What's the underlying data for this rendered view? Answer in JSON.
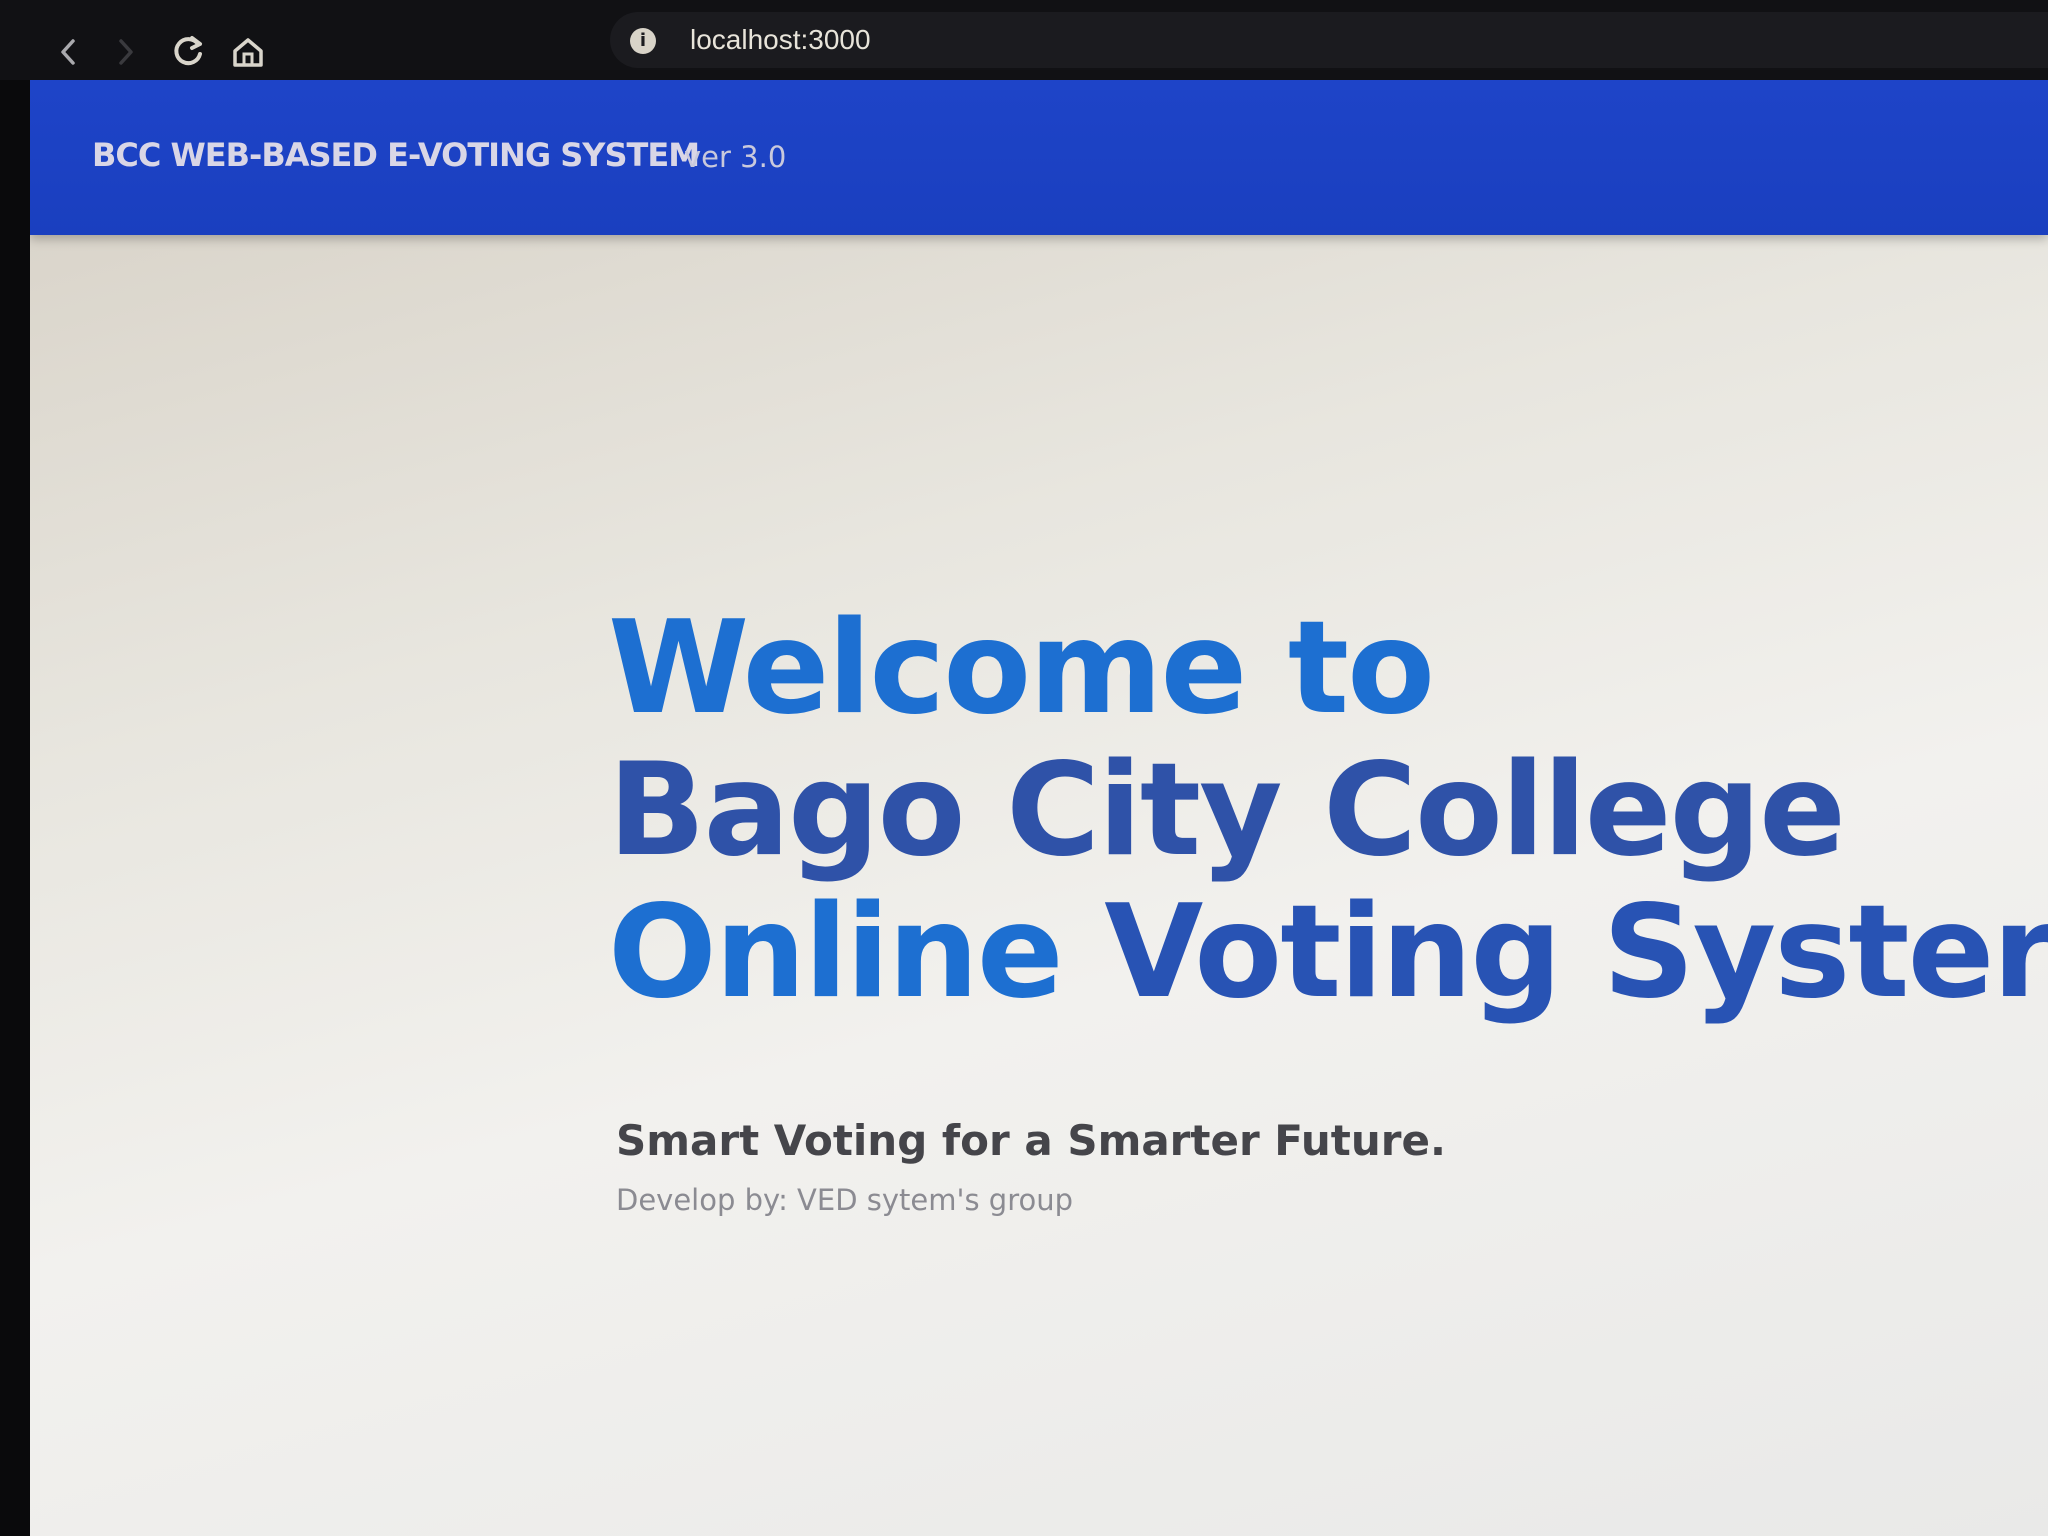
{
  "browser": {
    "url": "localhost:3000",
    "nav_icons": [
      "back-icon",
      "forward-icon",
      "reload-icon",
      "home-icon"
    ],
    "site_info_icon": "info-icon",
    "site_info_glyph": "i"
  },
  "header": {
    "title": "BCC WEB-BASED E-VOTING SYSTEM",
    "version": "ver 3.0",
    "background_color": "#1a3fbf"
  },
  "hero": {
    "line1": "Welcome to",
    "line2": "Bago City College",
    "line3_part1": "Online ",
    "line3_part2": "Voting ",
    "line3_part3": "Syster",
    "tagline": "Smart Voting for a Smarter Future.",
    "developer": "Develop by: VED sytem's group",
    "primary_color": "#1d6fd1",
    "secondary_color": "#2f52a8"
  }
}
